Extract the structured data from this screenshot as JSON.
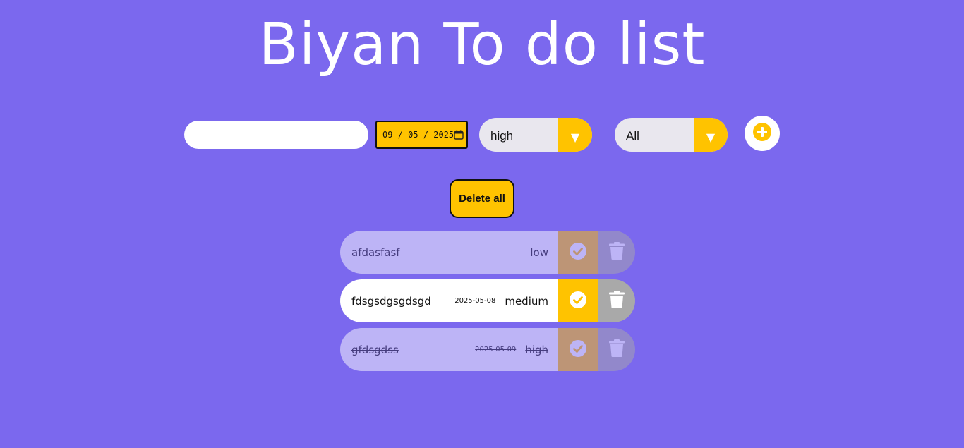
{
  "app": {
    "title": "Biyan To do list"
  },
  "controls": {
    "todo_input": {
      "value": "",
      "placeholder": ""
    },
    "date": {
      "value": "09 / 05 / 2025",
      "icon": "calendar-icon"
    },
    "priority_select": {
      "selected": "high",
      "arrow": "▼"
    },
    "filter_select": {
      "selected": "All",
      "arrow": "▼"
    },
    "add_button": {
      "icon": "plus-circle-icon"
    },
    "delete_all_label": "Delete all"
  },
  "todos": [
    {
      "text": "afdasfasf",
      "date": "",
      "priority": "low",
      "completed": true
    },
    {
      "text": "fdsgsdgsgdsgd",
      "date": "2025-05-08",
      "priority": "medium",
      "completed": false
    },
    {
      "text": "gfdsgdss",
      "date": "2025-05-09",
      "priority": "high",
      "completed": true
    }
  ],
  "icons": {
    "check": "check-circle-icon",
    "trash": "trash-icon"
  },
  "colors": {
    "background": "#7b68ee",
    "accent": "#ffc300",
    "trash": "#a9a9a9",
    "text": "#111111",
    "white": "#ffffff"
  }
}
